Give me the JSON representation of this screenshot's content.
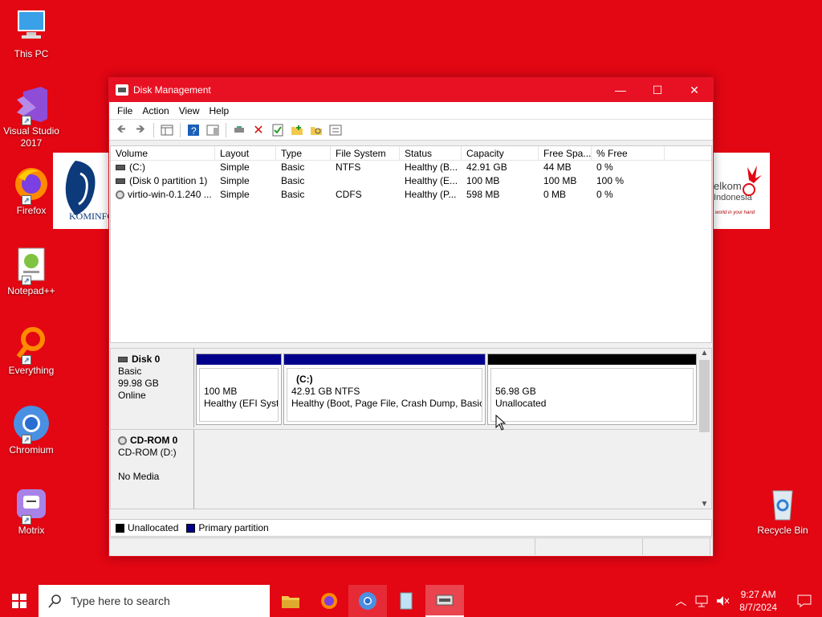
{
  "desktop": {
    "icons": [
      {
        "label": "This PC"
      },
      {
        "label": "Visual Studio 2017"
      },
      {
        "label": "Firefox"
      },
      {
        "label": "Notepad++"
      },
      {
        "label": "Everything"
      },
      {
        "label": "Chromium"
      },
      {
        "label": "Motrix"
      },
      {
        "label": "Recycle Bin"
      }
    ],
    "banner_left": "KOMINFO",
    "banner_right_line1": "elkom",
    "banner_right_line2": "Indonesia",
    "banner_right_tagline": "world in your hand"
  },
  "window": {
    "title": "Disk Management",
    "menu": [
      "File",
      "Action",
      "View",
      "Help"
    ],
    "volume_columns": [
      "Volume",
      "Layout",
      "Type",
      "File System",
      "Status",
      "Capacity",
      "Free Spa...",
      "% Free"
    ],
    "volumes": [
      {
        "volume": "(C:)",
        "layout": "Simple",
        "type": "Basic",
        "fs": "NTFS",
        "status": "Healthy (B...",
        "capacity": "42.91 GB",
        "free": "44 MB",
        "pct": "0 %"
      },
      {
        "volume": "(Disk 0 partition 1)",
        "layout": "Simple",
        "type": "Basic",
        "fs": "",
        "status": "Healthy (E...",
        "capacity": "100 MB",
        "free": "100 MB",
        "pct": "100 %"
      },
      {
        "volume": "virtio-win-0.1.240 ...",
        "layout": "Simple",
        "type": "Basic",
        "fs": "CDFS",
        "status": "Healthy (P...",
        "capacity": "598 MB",
        "free": "0 MB",
        "pct": "0 %"
      }
    ],
    "disks": {
      "disk0": {
        "name": "Disk 0",
        "type": "Basic",
        "size": "99.98 GB",
        "state": "Online",
        "partitions": [
          {
            "size": "100 MB",
            "desc": "Healthy (EFI Syste"
          },
          {
            "label": "(C:)",
            "size": "42.91 GB NTFS",
            "desc": "Healthy (Boot, Page File, Crash Dump, Basic D"
          },
          {
            "size": "56.98 GB",
            "desc": "Unallocated"
          }
        ]
      },
      "cdrom0": {
        "name": "CD-ROM 0",
        "drive": "CD-ROM (D:)",
        "media": "No Media"
      }
    },
    "legend": {
      "unallocated": "Unallocated",
      "primary": "Primary partition"
    },
    "colors": {
      "primary": "#00008b",
      "unallocated": "#000000",
      "title_bar": "#e81123"
    }
  },
  "taskbar": {
    "search_placeholder": "Type here to search",
    "time": "9:27 AM",
    "date": "8/7/2024"
  }
}
